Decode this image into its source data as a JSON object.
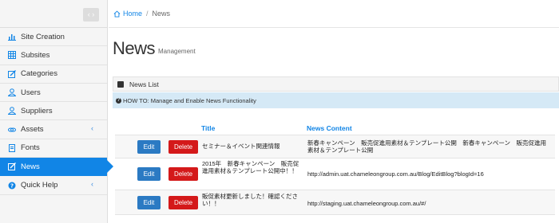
{
  "sidebar": {
    "collapse_label": "‹ ›",
    "items": [
      {
        "label": "Site Creation",
        "icon": "bar-chart-icon"
      },
      {
        "label": "Subsites",
        "icon": "grid-icon"
      },
      {
        "label": "Categories",
        "icon": "edit-icon"
      },
      {
        "label": "Users",
        "icon": "user-icon"
      },
      {
        "label": "Suppliers",
        "icon": "user-icon"
      },
      {
        "label": "Assets",
        "icon": "link-icon",
        "chevron": "‹"
      },
      {
        "label": "Fonts",
        "icon": "file-icon"
      },
      {
        "label": "News",
        "icon": "edit-icon",
        "active": true
      },
      {
        "label": "Quick Help",
        "icon": "question-circle-icon",
        "chevron": "‹"
      }
    ]
  },
  "breadcrumb": {
    "home": "Home",
    "separator": "/",
    "current": "News"
  },
  "page": {
    "title": "News",
    "subtitle": "Management"
  },
  "panel": {
    "title": "News List",
    "howto": "HOW TO: Manage and Enable News Functionality"
  },
  "table": {
    "headers": {
      "title": "Title",
      "content": "News Content"
    },
    "edit_label": "Edit",
    "delete_label": "Delete",
    "rows": [
      {
        "title": "セミナー＆イベント関連情報",
        "content": "新春キャンペーン　販売促進用素材＆テンプレート公開　新春キャンペーン　販売促進用素材＆テンプレート公開"
      },
      {
        "title": "2015年　新春キャンペーン　販売促進用素材＆テンプレート公開中！！",
        "content": "http://admin.uat.chameleongroup.com.au/Blog/EditBlog?blogId=16"
      },
      {
        "title": "販促素材更新しました！確認ください！！",
        "content": "http://staging.uat.chameleongroup.com.au/#/"
      }
    ]
  },
  "colors": {
    "accent": "#1185e6",
    "edit": "#2b7ac3",
    "delete": "#d4191a",
    "howto_bg": "#d5e9f6"
  }
}
